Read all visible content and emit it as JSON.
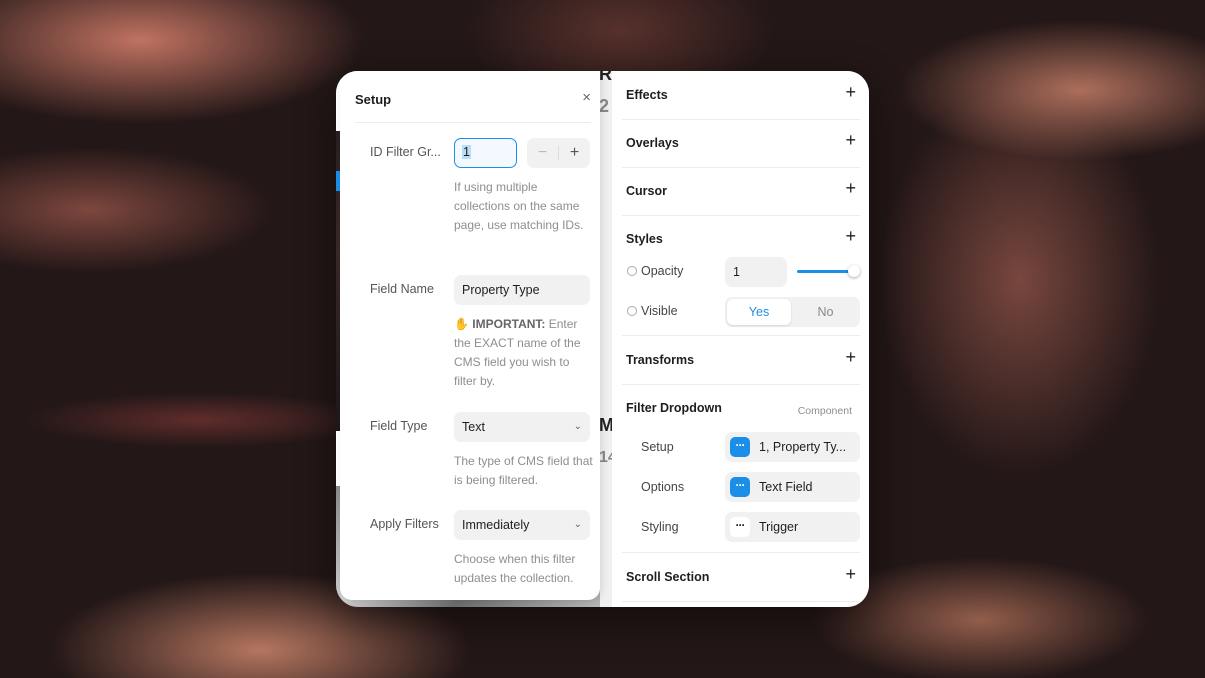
{
  "setup": {
    "title": "Setup",
    "close_icon": "×",
    "id_filter": {
      "label": "ID Filter Gr...",
      "value": "1",
      "minus": "−",
      "plus": "+",
      "help": "If using multiple collections on the same page, use matching IDs."
    },
    "field_name": {
      "label": "Field Name",
      "value": "Property Type",
      "help_emoji": "✋",
      "help_strong": "IMPORTANT:",
      "help": "Enter the EXACT name of the CMS field you wish to filter by."
    },
    "field_type": {
      "label": "Field Type",
      "value": "Text",
      "help": "The type of CMS field that is being filtered."
    },
    "apply_filters": {
      "label": "Apply Filters",
      "value": "Immediately",
      "help": "Choose when this filter updates the collection."
    }
  },
  "canvas": {
    "letter_a": "R",
    "letter_b": "2",
    "letter_c": "M",
    "letter_d": "14"
  },
  "panel": {
    "effects": "Effects",
    "overlays": "Overlays",
    "cursor": "Cursor",
    "styles": {
      "title": "Styles",
      "opacity_label": "Opacity",
      "opacity_value": "1",
      "opacity_level": 1,
      "visible_label": "Visible",
      "yes": "Yes",
      "no": "No"
    },
    "transforms": "Transforms",
    "filter_dropdown": {
      "title": "Filter Dropdown",
      "tag": "Component",
      "setup_label": "Setup",
      "setup_value": "1, Property Ty...",
      "options_label": "Options",
      "options_value": "Text Field",
      "styling_label": "Styling",
      "styling_value": "Trigger"
    },
    "scroll_section": "Scroll Section",
    "plus": "+"
  },
  "colors": {
    "accent": "#1b8fe8"
  }
}
